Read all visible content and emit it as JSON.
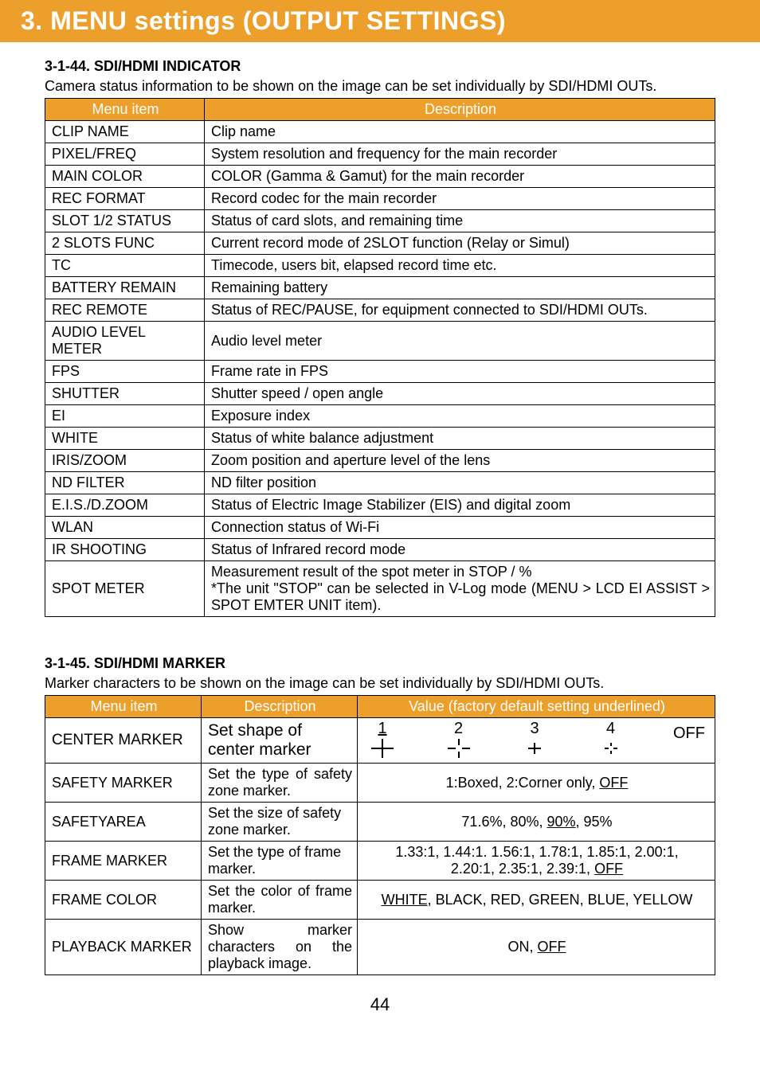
{
  "banner": "3. MENU settings (OUTPUT SETTINGS)",
  "section44": {
    "title": "3-1-44. SDI/HDMI INDICATOR",
    "intro": "Camera status information to be shown on the image can be set individually by SDI/HDMI OUTs.",
    "header_menu": "Menu item",
    "header_desc": "Description",
    "rows": [
      {
        "m": "CLIP NAME",
        "d": "Clip name"
      },
      {
        "m": "PIXEL/FREQ",
        "d": "System resolution and frequency for the main recorder"
      },
      {
        "m": "MAIN COLOR",
        "d": "COLOR (Gamma & Gamut) for the main recorder"
      },
      {
        "m": "REC FORMAT",
        "d": "Record codec for the main recorder"
      },
      {
        "m": "SLOT 1/2 STATUS",
        "d": "Status of card slots, and remaining time"
      },
      {
        "m": "2 SLOTS FUNC",
        "d": "Current record mode of 2SLOT function (Relay or Simul)"
      },
      {
        "m": "TC",
        "d": "Timecode, users bit, elapsed record time etc."
      },
      {
        "m": "BATTERY REMAIN",
        "d": "Remaining battery"
      },
      {
        "m": "REC REMOTE",
        "d": "Status of REC/PAUSE, for equipment connected to SDI/HDMI OUTs."
      },
      {
        "m": "AUDIO LEVEL METER",
        "d": "Audio level meter"
      },
      {
        "m": "FPS",
        "d": "Frame rate in FPS"
      },
      {
        "m": "SHUTTER",
        "d": "Shutter speed / open angle"
      },
      {
        "m": "EI",
        "d": "Exposure index"
      },
      {
        "m": "WHITE",
        "d": "Status of white balance adjustment"
      },
      {
        "m": "IRIS/ZOOM",
        "d": "Zoom position and aperture level of the lens"
      },
      {
        "m": "ND FILTER",
        "d": "ND filter position"
      },
      {
        "m": "E.I.S./D.ZOOM",
        "d": "Status of Electric Image Stabilizer (EIS) and digital zoom"
      },
      {
        "m": "WLAN",
        "d": "Connection status of Wi-Fi"
      },
      {
        "m": "IR SHOOTING",
        "d": "Status of Infrared record mode"
      },
      {
        "m": "SPOT METER",
        "d": "Measurement result of the spot meter in STOP / %\n*The unit \"STOP\" can be selected in V-Log mode (MENU > LCD EI ASSIST > SPOT EMTER UNIT item)."
      }
    ]
  },
  "section45": {
    "title": "3-1-45. SDI/HDMI MARKER",
    "intro": "Marker characters to be shown on the image can be set individually by SDI/HDMI OUTs.",
    "header_menu": "Menu item",
    "header_desc": "Description",
    "header_val": "Value (factory default setting underlined)",
    "rows": {
      "center": {
        "m": "CENTER MARKER",
        "d": "Set shape of center marker",
        "nums": {
          "n1": "1",
          "n2": "2",
          "n3": "3",
          "n4": "4"
        },
        "off": "OFF"
      },
      "safetymarker": {
        "m": "SAFETY MARKER",
        "d": "Set the type of safety zone marker.",
        "v_pre": "1:Boxed, 2:Corner only, ",
        "v_u": "OFF"
      },
      "safetyarea": {
        "m": "SAFETYAREA",
        "d": "Set the size of safety zone marker.",
        "v_pre": "71.6%, 80%, ",
        "v_u": "90%",
        "v_post": ", 95%"
      },
      "framemarker": {
        "m": "FRAME MARKER",
        "d": "Set the type of frame marker.",
        "v_line1": "1.33:1, 1.44:1. 1.56:1, 1.78:1, 1.85:1, 2.00:1,",
        "v_line2_pre": "2.20:1, 2.35:1, 2.39:1, ",
        "v_line2_u": "OFF"
      },
      "framecolor": {
        "m": "FRAME COLOR",
        "d": "Set the color of frame marker.",
        "v_u": "WHITE",
        "v_post": ", BLACK, RED, GREEN, BLUE, YELLOW"
      },
      "playback": {
        "m": "PLAYBACK MARKER",
        "d": "Show marker characters on the playback image.",
        "v_pre": "ON, ",
        "v_u": "OFF"
      }
    }
  },
  "page": "44"
}
